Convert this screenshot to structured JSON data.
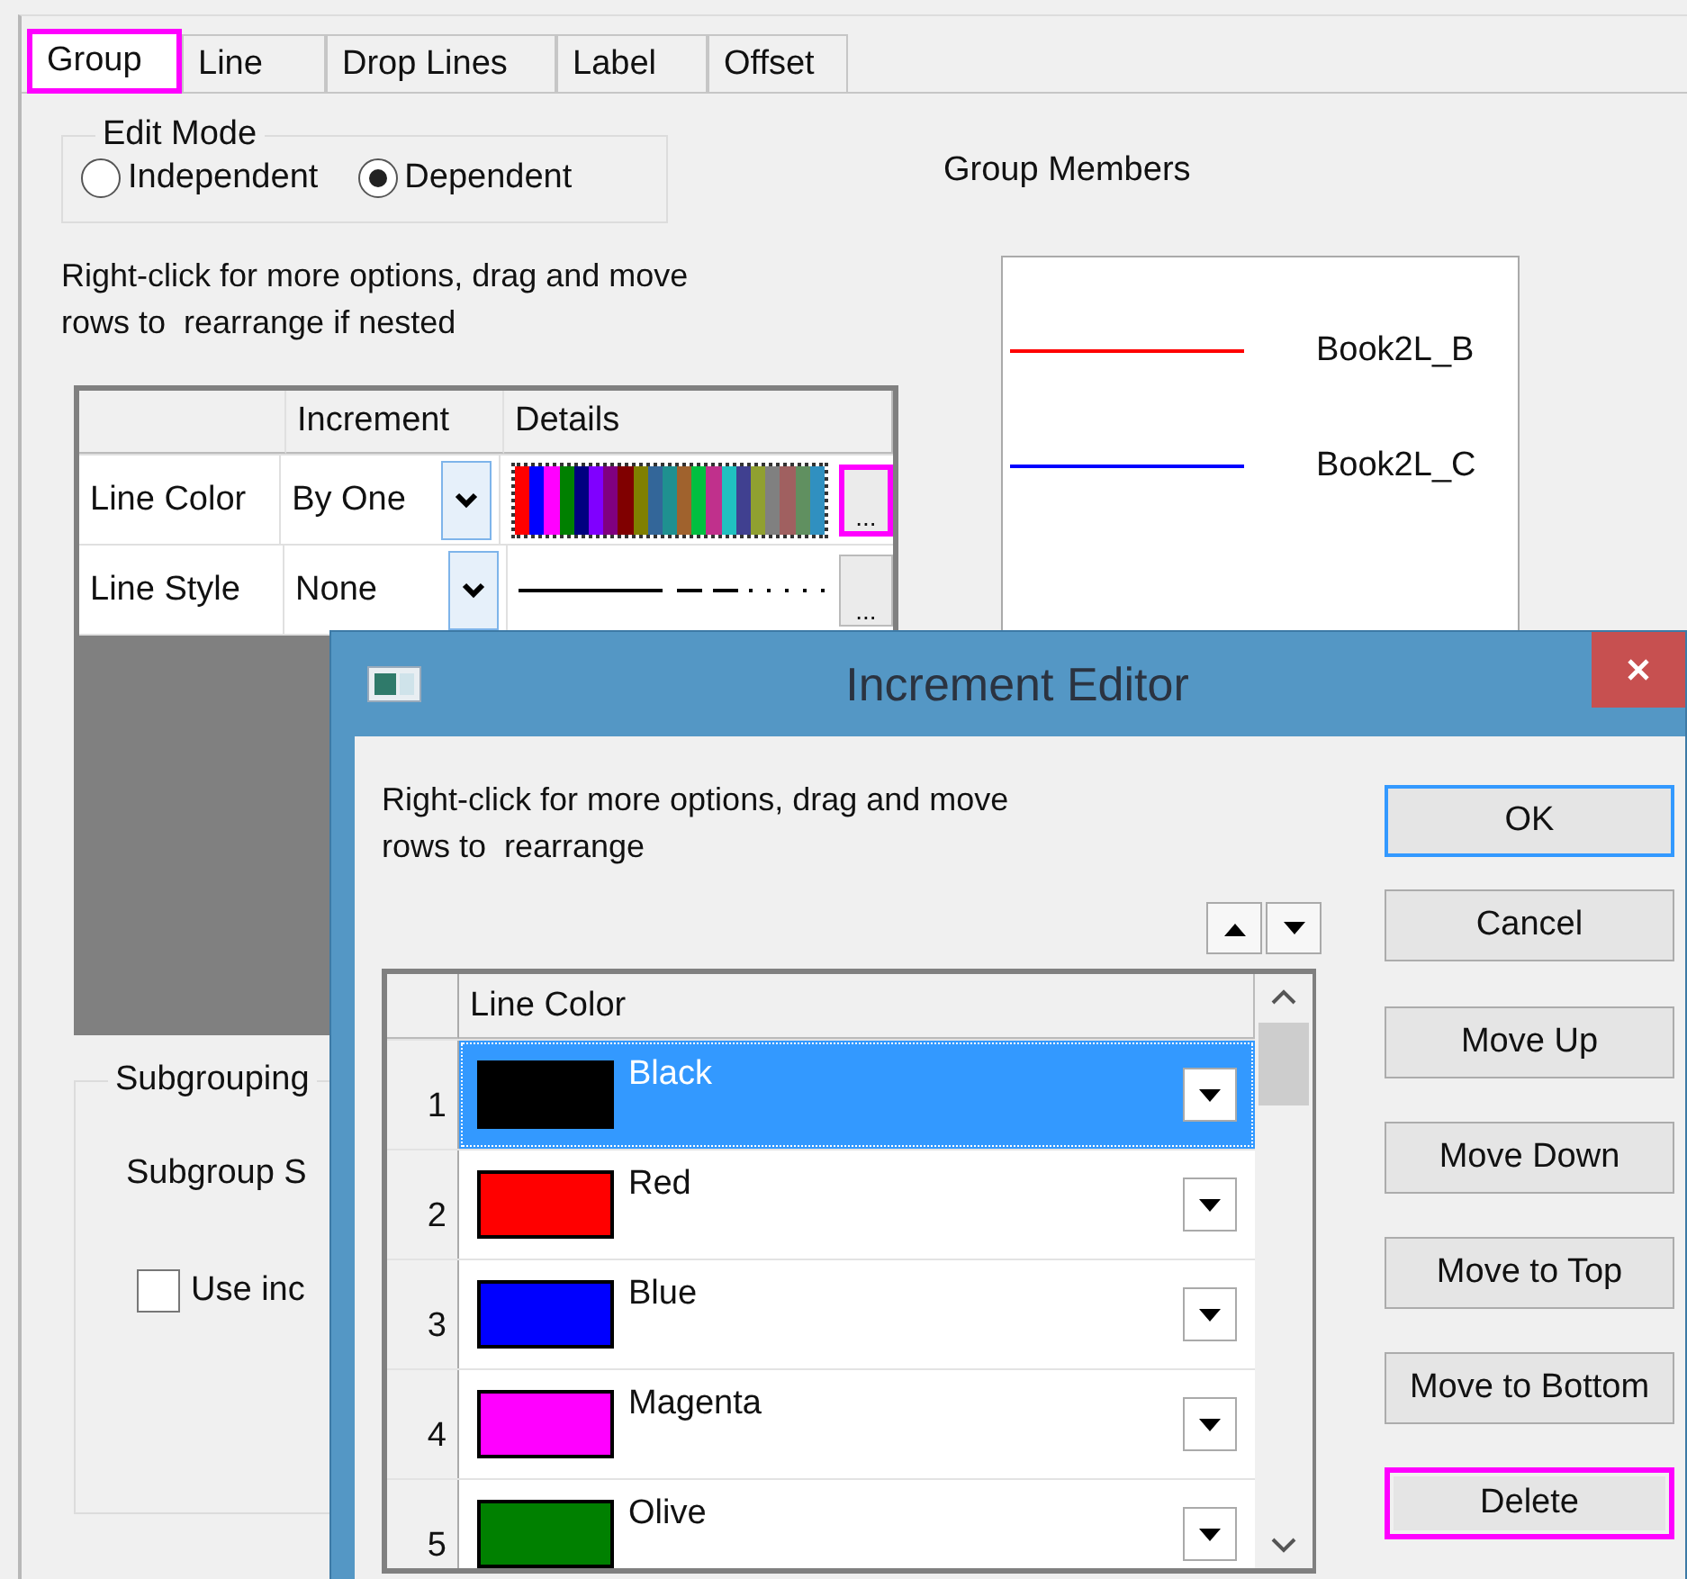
{
  "tabs": [
    {
      "label": "Group",
      "selected": true,
      "highlighted": true
    },
    {
      "label": "Line",
      "selected": false,
      "highlighted": false
    },
    {
      "label": "Drop Lines",
      "selected": false,
      "highlighted": false
    },
    {
      "label": "Label",
      "selected": false,
      "highlighted": false
    },
    {
      "label": "Offset",
      "selected": false,
      "highlighted": false
    }
  ],
  "edit_mode": {
    "title": "Edit Mode",
    "options": [
      {
        "label": "Independent",
        "selected": false
      },
      {
        "label": "Dependent",
        "selected": true
      }
    ]
  },
  "instructions": [
    "Right-click for more options, drag and move",
    "rows to  rearrange if nested"
  ],
  "increment_grid": {
    "columns": [
      "Increment",
      "Details"
    ],
    "rows": [
      {
        "label": "Line Color",
        "increment": "By One",
        "details": {
          "kind": "palette"
        },
        "button": "...",
        "highlighted": true
      },
      {
        "label": "Line Style",
        "increment": "None",
        "details": {
          "kind": "line_styles"
        },
        "button": "...",
        "highlighted": false
      }
    ]
  },
  "subgrouping": {
    "title": "Subgrouping",
    "label": "Subgroup S",
    "checkbox": {
      "label": "Use inc",
      "checked": false
    }
  },
  "group_members": {
    "title": "Group Members",
    "items": [
      {
        "name": "Book2L_B",
        "color": "#ff0000"
      },
      {
        "name": "Book2L_C",
        "color": "#0000ff"
      }
    ]
  },
  "dialog": {
    "title": "Increment Editor",
    "instructions": [
      "Right-click for more options, drag and move",
      "rows to  rearrange"
    ],
    "column": "Line Color",
    "rows": [
      {
        "number": "1",
        "name": "Black",
        "color": "#000000",
        "selected": true
      },
      {
        "number": "2",
        "name": "Red",
        "color": "#ff0000",
        "selected": false
      },
      {
        "number": "3",
        "name": "Blue",
        "color": "#0000ff",
        "selected": false
      },
      {
        "number": "4",
        "name": "Magenta",
        "color": "#ff00ff",
        "selected": false
      },
      {
        "number": "5",
        "name": "Olive",
        "color": "#008000",
        "selected": false
      }
    ],
    "buttons": [
      {
        "label": "OK",
        "default": true,
        "highlighted": false
      },
      {
        "label": "Cancel",
        "default": false,
        "highlighted": false
      },
      {
        "label": "Move Up",
        "default": false,
        "highlighted": false
      },
      {
        "label": "Move Down",
        "default": false,
        "highlighted": false
      },
      {
        "label": "Move to Top",
        "default": false,
        "highlighted": false
      },
      {
        "label": "Move to Bottom",
        "default": false,
        "highlighted": false
      },
      {
        "label": "Delete",
        "default": false,
        "highlighted": true
      }
    ]
  }
}
